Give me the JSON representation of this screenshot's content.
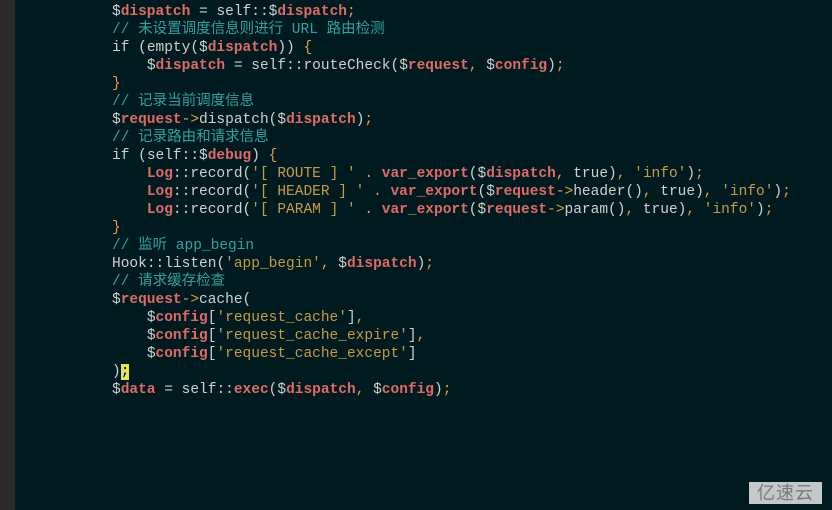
{
  "watermark": "亿速云",
  "chart_data": {
    "type": "table",
    "title": "PHP source snippet (ThinkPHP App::run style)",
    "lines": [
      {
        "tokens": [
          {
            "t": "$",
            "c": "varp"
          },
          {
            "t": "dispatch",
            "c": "var"
          },
          {
            "t": " = ",
            "c": "plain"
          },
          {
            "t": "self",
            "c": "self"
          },
          {
            "t": "::",
            "c": "sym"
          },
          {
            "t": "$",
            "c": "varp"
          },
          {
            "t": "dispatch",
            "c": "var"
          },
          {
            "t": ";",
            "c": "punc"
          }
        ]
      },
      {
        "tokens": []
      },
      {
        "tokens": [
          {
            "t": "// 未设置调度信息则进行 URL 路由检测",
            "c": "comment"
          }
        ]
      },
      {
        "tokens": [
          {
            "t": "if",
            "c": "keyword"
          },
          {
            "t": " (",
            "c": "sym"
          },
          {
            "t": "empty",
            "c": "func"
          },
          {
            "t": "(",
            "c": "sym"
          },
          {
            "t": "$",
            "c": "varp"
          },
          {
            "t": "dispatch",
            "c": "var"
          },
          {
            "t": "))",
            "c": "sym"
          },
          {
            "t": " {",
            "c": "punc"
          }
        ]
      },
      {
        "indent": 1,
        "tokens": [
          {
            "t": "$",
            "c": "varp"
          },
          {
            "t": "dispatch",
            "c": "var"
          },
          {
            "t": " = ",
            "c": "plain"
          },
          {
            "t": "self",
            "c": "self"
          },
          {
            "t": "::",
            "c": "sym"
          },
          {
            "t": "routeCheck",
            "c": "func"
          },
          {
            "t": "(",
            "c": "sym"
          },
          {
            "t": "$",
            "c": "varp"
          },
          {
            "t": "request",
            "c": "var"
          },
          {
            "t": ",",
            "c": "punc"
          },
          {
            "t": " ",
            "c": "plain"
          },
          {
            "t": "$",
            "c": "varp"
          },
          {
            "t": "config",
            "c": "var"
          },
          {
            "t": ")",
            "c": "sym"
          },
          {
            "t": ";",
            "c": "punc"
          }
        ]
      },
      {
        "tokens": [
          {
            "t": "}",
            "c": "punc"
          }
        ]
      },
      {
        "tokens": []
      },
      {
        "tokens": [
          {
            "t": "// 记录当前调度信息",
            "c": "comment"
          }
        ]
      },
      {
        "tokens": [
          {
            "t": "$",
            "c": "varp"
          },
          {
            "t": "request",
            "c": "var"
          },
          {
            "t": "->",
            "c": "arrow"
          },
          {
            "t": "dispatch",
            "c": "func"
          },
          {
            "t": "(",
            "c": "sym"
          },
          {
            "t": "$",
            "c": "varp"
          },
          {
            "t": "dispatch",
            "c": "var"
          },
          {
            "t": ")",
            "c": "sym"
          },
          {
            "t": ";",
            "c": "punc"
          }
        ]
      },
      {
        "tokens": []
      },
      {
        "tokens": [
          {
            "t": "// 记录路由和请求信息",
            "c": "comment"
          }
        ]
      },
      {
        "tokens": [
          {
            "t": "if",
            "c": "keyword"
          },
          {
            "t": " (",
            "c": "sym"
          },
          {
            "t": "self",
            "c": "self"
          },
          {
            "t": "::",
            "c": "sym"
          },
          {
            "t": "$",
            "c": "varp"
          },
          {
            "t": "debug",
            "c": "var"
          },
          {
            "t": ")",
            "c": "sym"
          },
          {
            "t": " {",
            "c": "punc"
          }
        ]
      },
      {
        "indent": 1,
        "tokens": [
          {
            "t": "Log",
            "c": "var"
          },
          {
            "t": "::",
            "c": "sym"
          },
          {
            "t": "record",
            "c": "func"
          },
          {
            "t": "(",
            "c": "sym"
          },
          {
            "t": "'[ ROUTE ] '",
            "c": "string"
          },
          {
            "t": " ",
            "c": "plain"
          },
          {
            "t": ".",
            "c": "punc"
          },
          {
            "t": " ",
            "c": "plain"
          },
          {
            "t": "var_export",
            "c": "var"
          },
          {
            "t": "(",
            "c": "sym"
          },
          {
            "t": "$",
            "c": "varp"
          },
          {
            "t": "dispatch",
            "c": "var"
          },
          {
            "t": ",",
            "c": "punc"
          },
          {
            "t": " ",
            "c": "plain"
          },
          {
            "t": "true",
            "c": "bool"
          },
          {
            "t": ")",
            "c": "sym"
          },
          {
            "t": ",",
            "c": "punc"
          },
          {
            "t": " ",
            "c": "plain"
          },
          {
            "t": "'info'",
            "c": "string"
          },
          {
            "t": ")",
            "c": "sym"
          },
          {
            "t": ";",
            "c": "punc"
          }
        ]
      },
      {
        "indent": 1,
        "tokens": [
          {
            "t": "Log",
            "c": "var"
          },
          {
            "t": "::",
            "c": "sym"
          },
          {
            "t": "record",
            "c": "func"
          },
          {
            "t": "(",
            "c": "sym"
          },
          {
            "t": "'[ HEADER ] '",
            "c": "string"
          },
          {
            "t": " ",
            "c": "plain"
          },
          {
            "t": ".",
            "c": "punc"
          },
          {
            "t": " ",
            "c": "plain"
          },
          {
            "t": "var_export",
            "c": "var"
          },
          {
            "t": "(",
            "c": "sym"
          },
          {
            "t": "$",
            "c": "varp"
          },
          {
            "t": "request",
            "c": "var"
          },
          {
            "t": "->",
            "c": "arrow"
          },
          {
            "t": "header",
            "c": "func"
          },
          {
            "t": "()",
            "c": "sym"
          },
          {
            "t": ",",
            "c": "punc"
          },
          {
            "t": " ",
            "c": "plain"
          },
          {
            "t": "true",
            "c": "bool"
          },
          {
            "t": ")",
            "c": "sym"
          },
          {
            "t": ",",
            "c": "punc"
          },
          {
            "t": " ",
            "c": "plain"
          },
          {
            "t": "'info'",
            "c": "string"
          },
          {
            "t": ")",
            "c": "sym"
          },
          {
            "t": ";",
            "c": "punc"
          }
        ]
      },
      {
        "indent": 1,
        "tokens": [
          {
            "t": "Log",
            "c": "var"
          },
          {
            "t": "::",
            "c": "sym"
          },
          {
            "t": "record",
            "c": "func"
          },
          {
            "t": "(",
            "c": "sym"
          },
          {
            "t": "'[ PARAM ] '",
            "c": "string"
          },
          {
            "t": " ",
            "c": "plain"
          },
          {
            "t": ".",
            "c": "punc"
          },
          {
            "t": " ",
            "c": "plain"
          },
          {
            "t": "var_export",
            "c": "var"
          },
          {
            "t": "(",
            "c": "sym"
          },
          {
            "t": "$",
            "c": "varp"
          },
          {
            "t": "request",
            "c": "var"
          },
          {
            "t": "->",
            "c": "arrow"
          },
          {
            "t": "param",
            "c": "func"
          },
          {
            "t": "()",
            "c": "sym"
          },
          {
            "t": ",",
            "c": "punc"
          },
          {
            "t": " ",
            "c": "plain"
          },
          {
            "t": "true",
            "c": "bool"
          },
          {
            "t": ")",
            "c": "sym"
          },
          {
            "t": ",",
            "c": "punc"
          },
          {
            "t": " ",
            "c": "plain"
          },
          {
            "t": "'info'",
            "c": "string"
          },
          {
            "t": ")",
            "c": "sym"
          },
          {
            "t": ";",
            "c": "punc"
          }
        ]
      },
      {
        "tokens": [
          {
            "t": "}",
            "c": "punc"
          }
        ]
      },
      {
        "tokens": []
      },
      {
        "tokens": [
          {
            "t": "// 监听 app_begin",
            "c": "comment"
          }
        ]
      },
      {
        "tokens": [
          {
            "t": "Hook",
            "c": "keyword"
          },
          {
            "t": "::",
            "c": "sym"
          },
          {
            "t": "listen",
            "c": "func"
          },
          {
            "t": "(",
            "c": "sym"
          },
          {
            "t": "'app_begin'",
            "c": "string"
          },
          {
            "t": ",",
            "c": "punc"
          },
          {
            "t": " ",
            "c": "plain"
          },
          {
            "t": "$",
            "c": "varp"
          },
          {
            "t": "dispatch",
            "c": "var"
          },
          {
            "t": ")",
            "c": "sym"
          },
          {
            "t": ";",
            "c": "punc"
          }
        ]
      },
      {
        "tokens": []
      },
      {
        "tokens": [
          {
            "t": "// 请求缓存检查",
            "c": "comment"
          }
        ]
      },
      {
        "tokens": [
          {
            "t": "$",
            "c": "varp"
          },
          {
            "t": "request",
            "c": "var"
          },
          {
            "t": "->",
            "c": "arrow"
          },
          {
            "t": "cache",
            "c": "func"
          },
          {
            "t": "(",
            "c": "sym"
          }
        ]
      },
      {
        "indent": 1,
        "tokens": [
          {
            "t": "$",
            "c": "varp"
          },
          {
            "t": "config",
            "c": "var"
          },
          {
            "t": "[",
            "c": "sym"
          },
          {
            "t": "'request_cache'",
            "c": "string"
          },
          {
            "t": "]",
            "c": "sym"
          },
          {
            "t": ",",
            "c": "punc"
          }
        ]
      },
      {
        "indent": 1,
        "tokens": [
          {
            "t": "$",
            "c": "varp"
          },
          {
            "t": "config",
            "c": "var"
          },
          {
            "t": "[",
            "c": "sym"
          },
          {
            "t": "'request_cache_expire'",
            "c": "string"
          },
          {
            "t": "]",
            "c": "sym"
          },
          {
            "t": ",",
            "c": "punc"
          }
        ]
      },
      {
        "indent": 1,
        "tokens": [
          {
            "t": "$",
            "c": "varp"
          },
          {
            "t": "config",
            "c": "var"
          },
          {
            "t": "[",
            "c": "sym"
          },
          {
            "t": "'request_cache_except'",
            "c": "string"
          },
          {
            "t": "]",
            "c": "sym"
          }
        ]
      },
      {
        "tokens": [
          {
            "t": ")",
            "c": "sym"
          },
          {
            "t": ";",
            "c": "hl"
          }
        ]
      },
      {
        "tokens": []
      },
      {
        "tokens": [
          {
            "t": "$",
            "c": "varp"
          },
          {
            "t": "data",
            "c": "var"
          },
          {
            "t": " = ",
            "c": "plain"
          },
          {
            "t": "self",
            "c": "self"
          },
          {
            "t": "::",
            "c": "sym"
          },
          {
            "t": "exec",
            "c": "var"
          },
          {
            "t": "(",
            "c": "sym"
          },
          {
            "t": "$",
            "c": "varp"
          },
          {
            "t": "dispatch",
            "c": "var"
          },
          {
            "t": ",",
            "c": "punc"
          },
          {
            "t": " ",
            "c": "plain"
          },
          {
            "t": "$",
            "c": "varp"
          },
          {
            "t": "config",
            "c": "var"
          },
          {
            "t": ")",
            "c": "sym"
          },
          {
            "t": ";",
            "c": "punc"
          }
        ]
      }
    ]
  }
}
